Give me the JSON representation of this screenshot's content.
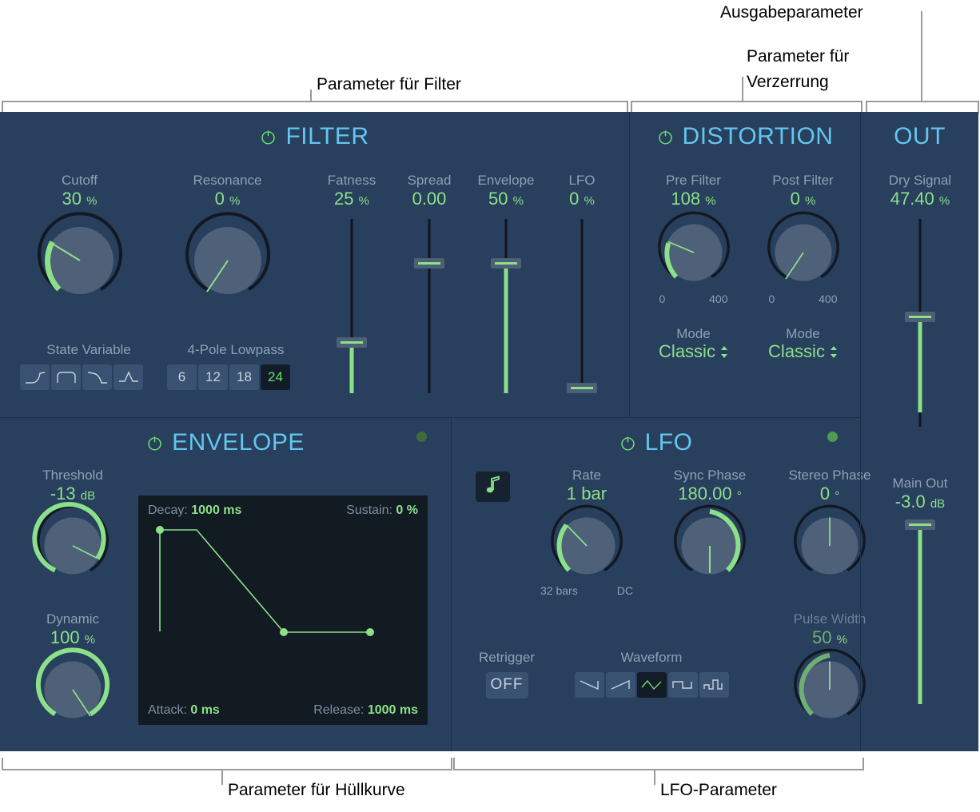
{
  "annotations": {
    "filter": "Parameter für Filter",
    "distortion": "Parameter für\nVerzerrung",
    "distortion_l1": "Parameter für",
    "distortion_l2": "Verzerrung",
    "output": "Ausgabeparameter",
    "envelope": "Parameter für Hüllkurve",
    "lfo": "LFO-Parameter"
  },
  "colors": {
    "panel_bg": "#283f5d",
    "title": "#63c6f0",
    "green": "#8de08a",
    "label": "#8ea0b5",
    "knob_face": "#50627c",
    "track": "#10161f"
  },
  "filter": {
    "title": "FILTER",
    "power_icon": "power-icon",
    "cutoff": {
      "label": "Cutoff",
      "value": "30",
      "unit": "%"
    },
    "resonance": {
      "label": "Resonance",
      "value": "0",
      "unit": "%"
    },
    "fatness": {
      "label": "Fatness",
      "value": "25",
      "unit": "%"
    },
    "spread": {
      "label": "Spread",
      "value": "0.00",
      "unit": ""
    },
    "envelope": {
      "label": "Envelope",
      "value": "50",
      "unit": "%"
    },
    "lfo": {
      "label": "LFO",
      "value": "0",
      "unit": "%"
    },
    "mode_group_label": "State Variable",
    "slope_group_label": "4-Pole Lowpass",
    "mode_buttons": [
      {
        "icon": "highpass-curve-icon",
        "selected": false
      },
      {
        "icon": "bandpass-curve-icon",
        "selected": false
      },
      {
        "icon": "lowpass-curve-icon",
        "selected": false
      },
      {
        "icon": "peak-curve-icon",
        "selected": false
      }
    ],
    "slope_buttons": [
      {
        "label": "6",
        "selected": false
      },
      {
        "label": "12",
        "selected": false
      },
      {
        "label": "18",
        "selected": false
      },
      {
        "label": "24",
        "selected": true
      }
    ]
  },
  "distortion": {
    "title": "DISTORTION",
    "power_icon": "power-icon",
    "pre_filter": {
      "label": "Pre Filter",
      "value": "108",
      "unit": "%",
      "scale_min": "0",
      "scale_max": "400"
    },
    "post_filter": {
      "label": "Post Filter",
      "value": "0",
      "unit": "%",
      "scale_min": "0",
      "scale_max": "400"
    },
    "pre_mode": {
      "label": "Mode",
      "value": "Classic",
      "icon": "chevron-updown-icon"
    },
    "post_mode": {
      "label": "Mode",
      "value": "Classic",
      "icon": "chevron-updown-icon"
    }
  },
  "out": {
    "title": "OUT",
    "dry_signal": {
      "label": "Dry Signal",
      "value": "47.40",
      "unit": "%"
    },
    "main_out": {
      "label": "Main Out",
      "value": "-3.0",
      "unit": "dB"
    }
  },
  "envelope": {
    "title": "ENVELOPE",
    "power_icon": "power-icon",
    "led": "activity-led",
    "threshold": {
      "label": "Threshold",
      "value": "-13",
      "unit": "dB"
    },
    "dynamic": {
      "label": "Dynamic",
      "value": "100",
      "unit": "%"
    },
    "display": {
      "decay_label": "Decay:",
      "decay_value": "1000 ms",
      "sustain_label": "Sustain:",
      "sustain_value": "0 %",
      "attack_label": "Attack:",
      "attack_value": "0 ms",
      "release_label": "Release:",
      "release_value": "1000 ms"
    }
  },
  "lfo": {
    "title": "LFO",
    "power_icon": "power-icon",
    "led": "activity-led",
    "sync_button": {
      "icon": "note-icon"
    },
    "rate": {
      "label": "Rate",
      "value": "1 bar",
      "scale_min": "32 bars",
      "scale_max": "DC"
    },
    "sync_phase": {
      "label": "Sync Phase",
      "value": "180.00",
      "unit": "°"
    },
    "stereo_phase": {
      "label": "Stereo Phase",
      "value": "0",
      "unit": "°"
    },
    "pulse_width": {
      "label": "Pulse Width",
      "value": "50",
      "unit": "%"
    },
    "retrigger": {
      "label": "Retrigger",
      "value": "OFF"
    },
    "waveform_label": "Waveform",
    "waveforms": [
      {
        "icon": "saw-down-icon",
        "selected": false
      },
      {
        "icon": "saw-up-icon",
        "selected": false
      },
      {
        "icon": "triangle-icon",
        "selected": true
      },
      {
        "icon": "square-icon",
        "selected": false
      },
      {
        "icon": "random-step-icon",
        "selected": false
      }
    ]
  }
}
